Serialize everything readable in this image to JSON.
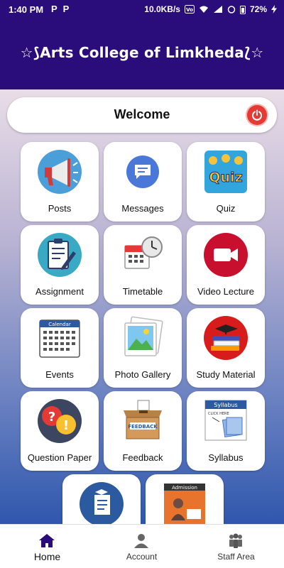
{
  "status_bar": {
    "time": "1:40 PM",
    "apps": [
      "P",
      "P"
    ],
    "network_speed": "10.0KB/s",
    "battery": "72%"
  },
  "header": {
    "title": "☆⟆Arts College of Limkheda⟅☆",
    "background": "#2a0c7a"
  },
  "welcome": {
    "text": "Welcome",
    "power_icon": "power-icon"
  },
  "tiles": [
    {
      "label": "Posts",
      "icon": "megaphone-icon"
    },
    {
      "label": "Messages",
      "icon": "message-icon"
    },
    {
      "label": "Quiz",
      "icon": "quiz-icon"
    },
    {
      "label": "Assignment",
      "icon": "assignment-icon"
    },
    {
      "label": "Timetable",
      "icon": "timetable-icon"
    },
    {
      "label": "Video Lecture",
      "icon": "video-icon"
    },
    {
      "label": "Events",
      "icon": "calendar-icon"
    },
    {
      "label": "Photo Gallery",
      "icon": "gallery-icon"
    },
    {
      "label": "Study Material",
      "icon": "books-icon"
    },
    {
      "label": "Question Paper",
      "icon": "question-icon"
    },
    {
      "label": "Feedback",
      "icon": "feedback-icon"
    },
    {
      "label": "Syllabus",
      "icon": "syllabus-icon"
    },
    {
      "label": "",
      "icon": "certificate-icon"
    },
    {
      "label": "",
      "icon": "admission-icon"
    }
  ],
  "icon_text": {
    "quiz": "Quiz",
    "calendar": "Calendar",
    "feedback": "FEEDBACK",
    "syllabus": "Syllabus",
    "syllabus_click": "CLICK HERE",
    "admission": "Admission"
  },
  "bottom_nav": [
    {
      "label": "Home",
      "icon": "home-icon",
      "active": true
    },
    {
      "label": "Account",
      "icon": "account-icon",
      "active": false
    },
    {
      "label": "Staff Area",
      "icon": "staff-icon",
      "active": false
    }
  ]
}
